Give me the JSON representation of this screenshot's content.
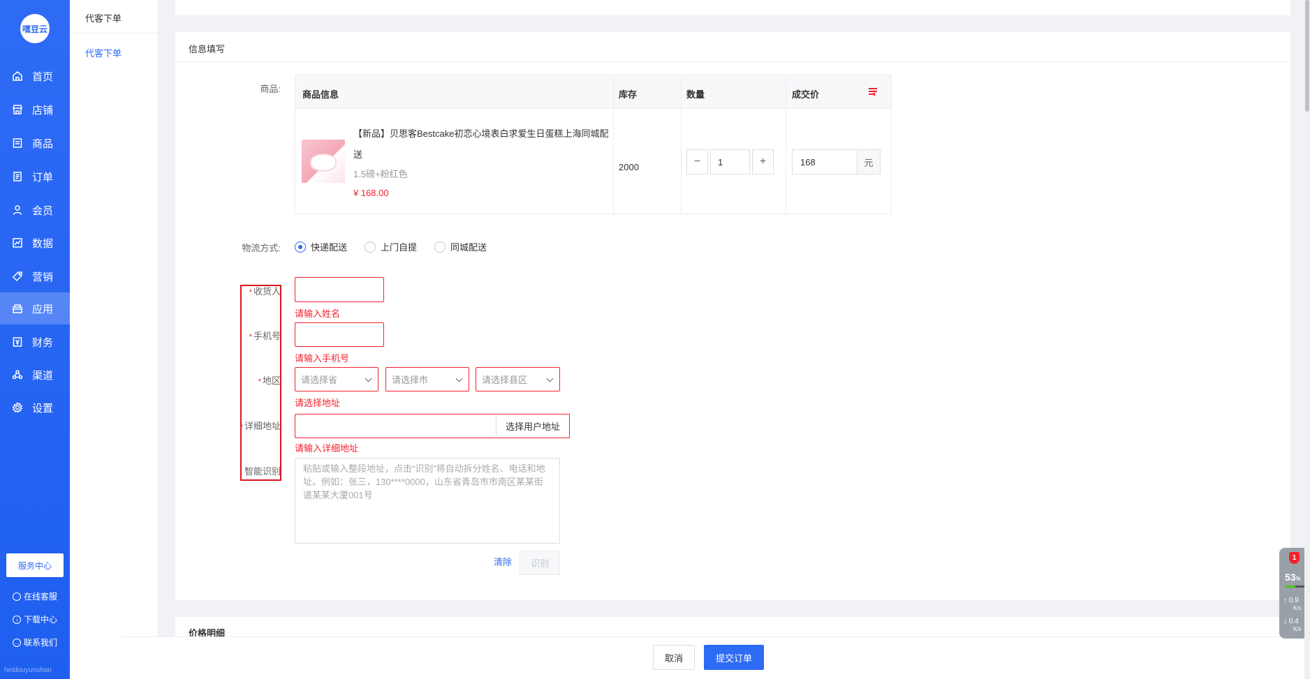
{
  "sidebar": {
    "logo": "嘿豆云",
    "items": [
      {
        "label": "首页",
        "icon": "home-icon"
      },
      {
        "label": "店铺",
        "icon": "store-icon"
      },
      {
        "label": "商品",
        "icon": "goods-icon"
      },
      {
        "label": "订单",
        "icon": "order-icon"
      },
      {
        "label": "会员",
        "icon": "member-icon"
      },
      {
        "label": "数据",
        "icon": "data-icon"
      },
      {
        "label": "营销",
        "icon": "tag-icon"
      },
      {
        "label": "应用",
        "icon": "app-icon",
        "active": true
      },
      {
        "label": "财务",
        "icon": "finance-icon"
      },
      {
        "label": "渠道",
        "icon": "channel-icon"
      },
      {
        "label": "设置",
        "icon": "gear-icon"
      }
    ],
    "service_center": "服务中心",
    "links": [
      "在线客服",
      "下载中心",
      "联系我们"
    ],
    "footer": "heidouyunshan"
  },
  "subnav": {
    "title": "代客下单",
    "item": "代客下单"
  },
  "form": {
    "section_title": "信息填写",
    "goods_label": "商品:",
    "table_headers": [
      "商品信息",
      "库存",
      "数量",
      "成交价"
    ],
    "product": {
      "name": "【新品】贝思客Bestcake初恋心境表白求爱生日蛋糕上海同城配送",
      "sku": "1.5磅+粉红色",
      "price": "¥ 168.00",
      "stock": "2000",
      "quantity": "1",
      "deal_price": "168",
      "unit": "元"
    },
    "logistics_label": "物流方式:",
    "logistics_options": [
      "快递配送",
      "上门自提",
      "同城配送"
    ],
    "logistics_selected": "快递配送",
    "receiver_label": "收货人",
    "receiver_error": "请输入姓名",
    "phone_label": "手机号",
    "phone_error": "请输入手机号",
    "region_label": "地区",
    "region_placeholders": [
      "请选择省",
      "请选择市",
      "请选择县区"
    ],
    "region_error": "请选择地址",
    "address_label": "详细地址",
    "address_button": "选择用户地址",
    "address_error": "请输入详细地址",
    "smart_label": "智能识别",
    "smart_placeholder": "粘贴或输入整段地址，点击“识别”将自动拆分姓名、电话和地址。例如：张三，130****0000，山东省青岛市市南区某某街道某某大厦001号",
    "clear_label": "清除",
    "recognize_label": "识别"
  },
  "price_section": {
    "title": "价格明细"
  },
  "footer_bar": {
    "cancel": "取消",
    "submit": "提交订单"
  },
  "widget": {
    "badge": "1",
    "percent": "53",
    "percent_unit": "%",
    "up": "0.9",
    "up_unit": "K/s",
    "down": "0.4",
    "down_unit": "K/s"
  },
  "colors": {
    "primary": "#2e6bf5",
    "error": "#f5222d"
  }
}
